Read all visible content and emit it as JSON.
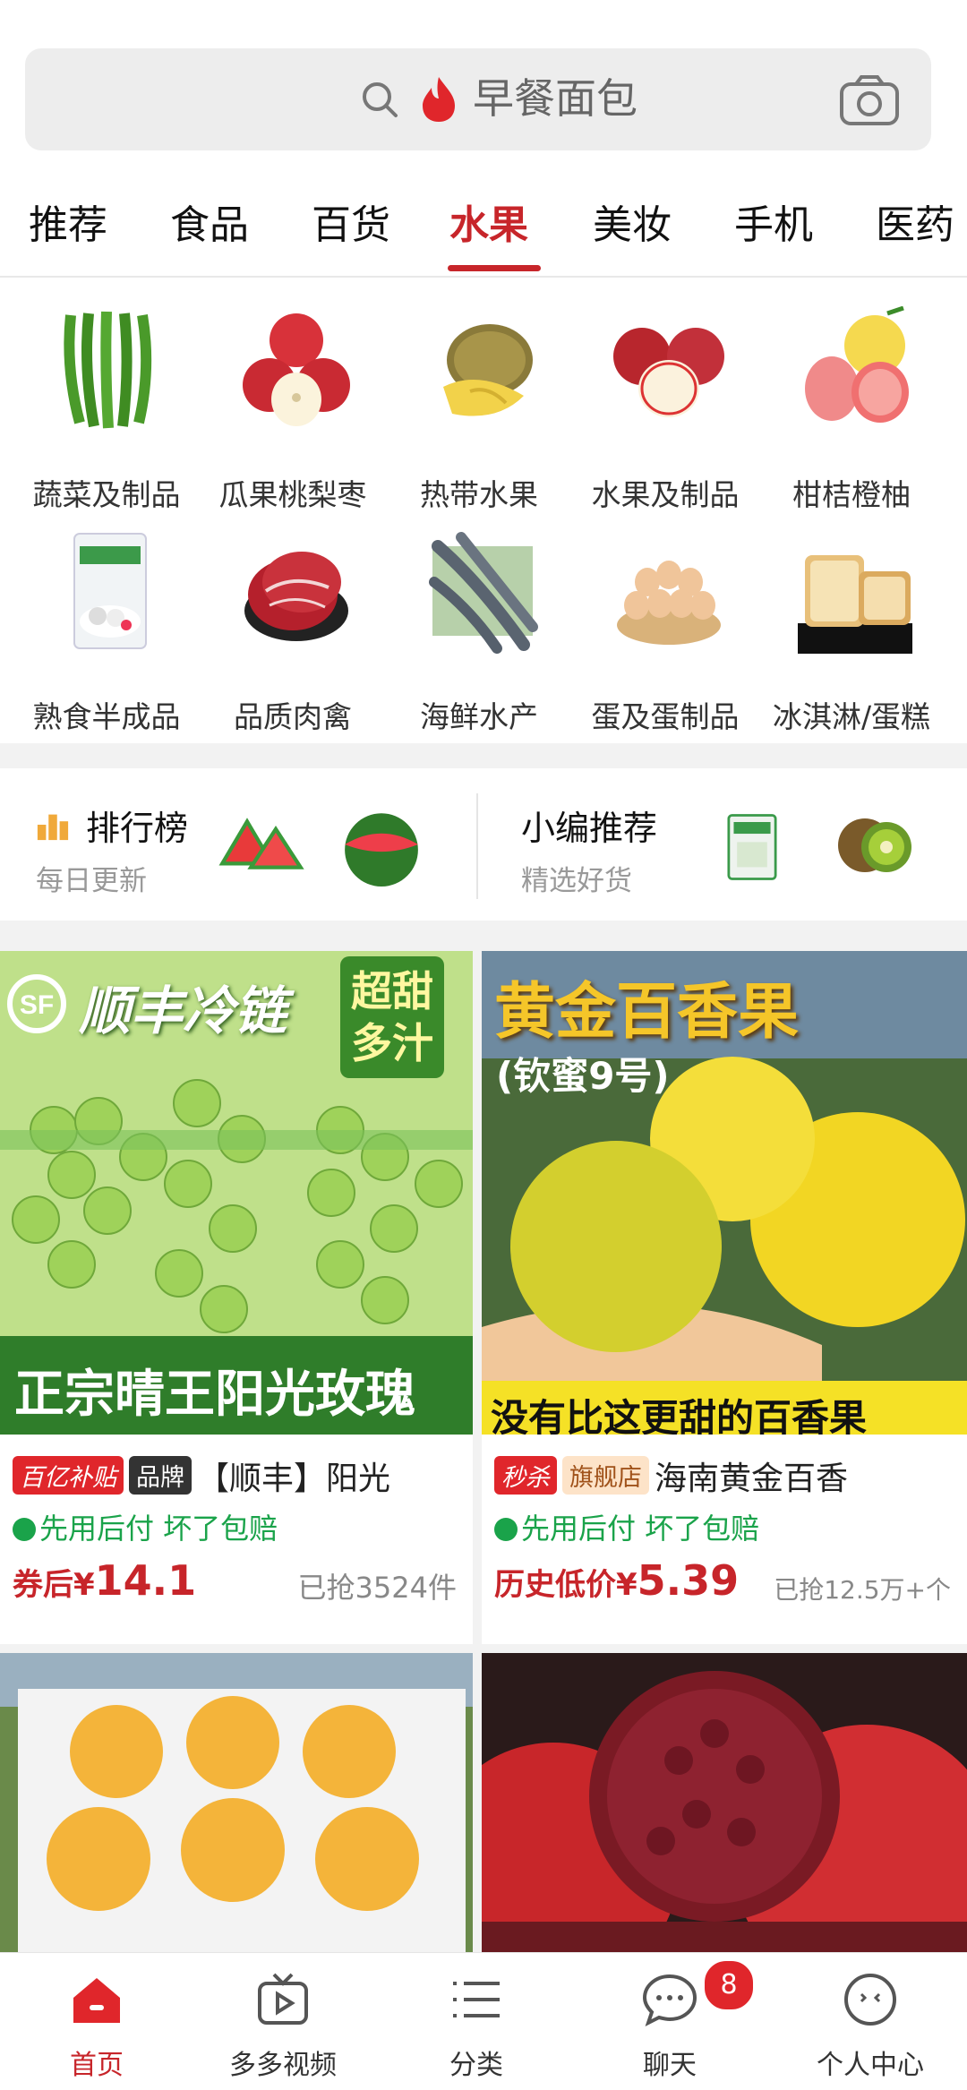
{
  "search": {
    "placeholder": "早餐面包"
  },
  "tabs": [
    "推荐",
    "食品",
    "百货",
    "水果",
    "美妆",
    "手机",
    "医药"
  ],
  "active_tab": "水果",
  "categories": [
    {
      "label": "蔬菜及制品",
      "icon": "green-beans-icon"
    },
    {
      "label": "瓜果桃梨枣",
      "icon": "apple-icon"
    },
    {
      "label": "热带水果",
      "icon": "durian-icon"
    },
    {
      "label": "水果及制品",
      "icon": "apple-cut-icon"
    },
    {
      "label": "柑桔橙柚",
      "icon": "pomelo-icon"
    },
    {
      "label": "熟食半成品",
      "icon": "package-icon"
    },
    {
      "label": "品质肉禽",
      "icon": "beef-slice-icon"
    },
    {
      "label": "海鲜水产",
      "icon": "shrimp-icon"
    },
    {
      "label": "蛋及蛋制品",
      "icon": "eggs-icon"
    },
    {
      "label": "冰淇淋/蛋糕",
      "icon": "bread-icon"
    }
  ],
  "rank": {
    "left": {
      "title": "排行榜",
      "subtitle": "每日更新"
    },
    "right": {
      "title": "小编推荐",
      "subtitle": "精选好货"
    }
  },
  "products": [
    {
      "banner_top": "顺丰冷链",
      "banner_tag": "超甜多汁",
      "banner_bottom": "正宗晴王阳光玫瑰",
      "badge1": "百亿补贴",
      "badge2": "品牌",
      "title": "【顺丰】阳光",
      "meta": "先用后付  坏了包赔",
      "price_prefix": "券后¥",
      "price": "14.1",
      "sold": "已抢3524件"
    },
    {
      "banner_top": "黄金百香果",
      "banner_sub": "(钦蜜9号)",
      "banner_bottom": "没有比这更甜的百香果",
      "badge1": "秒杀",
      "badge2": "旗舰店",
      "title": "海南黄金百香",
      "meta": "先用后付  坏了包赔",
      "price_prefix": "历史低价¥",
      "price": "5.39",
      "sold": "已抢12.5万+个"
    }
  ],
  "nav": [
    {
      "label": "首页",
      "icon": "home-icon"
    },
    {
      "label": "多多视频",
      "icon": "video-icon"
    },
    {
      "label": "分类",
      "icon": "list-icon"
    },
    {
      "label": "聊天",
      "icon": "chat-icon",
      "badge": "8"
    },
    {
      "label": "个人中心",
      "icon": "profile-icon"
    }
  ],
  "colors": {
    "accent": "#c7252a",
    "green": "#1aa34a"
  }
}
